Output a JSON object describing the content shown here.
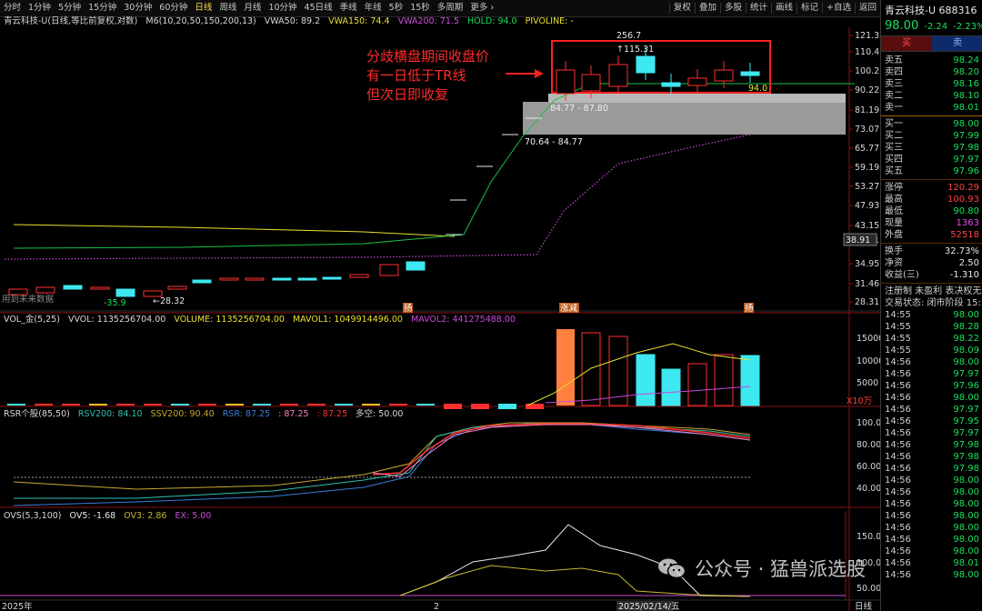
{
  "toolbar": {
    "periods": [
      "分时",
      "1分钟",
      "5分钟",
      "15分钟",
      "30分钟",
      "60分钟",
      "日线",
      "周线",
      "月线",
      "10分钟",
      "45日线",
      "季线",
      "年线",
      "5秒",
      "15秒",
      "多周期",
      "更多 ›"
    ],
    "active_period": "日线",
    "tools": [
      "复权",
      "叠加",
      "多股",
      "统计",
      "画线",
      "标记",
      "+自选",
      "返回"
    ]
  },
  "main_legend": {
    "name": "青云科技-U(日线,等比前复权,对数)",
    "ma": "M6(10,20,50,150,200,13)",
    "vwa50": "VWA50: 89.2",
    "vwa150": "VWA150: 74.4",
    "vwa200": "VWA200: 71.5",
    "hold": "HOLD: 94.0",
    "pivot": "PIVOLINE: -"
  },
  "price_axis": [
    "121.3",
    "110.42",
    "100.2",
    "90.22",
    "81.19",
    "73.07",
    "65.77",
    "59.19",
    "53.27",
    "47.93",
    "43.15",
    "38.91",
    "34.95",
    "31.46",
    "28.31"
  ],
  "main_labels": {
    "high_256": "256.7",
    "high_115": "115.31",
    "hold_val": "94.0",
    "low_2832": "←28.32",
    "neg_359": "-35.9",
    "range1": "84.77 - 87.80",
    "range2": "70.64 - 84.77",
    "cur_price": "38.91",
    "future": "用到未来数据",
    "tag_a": "扬",
    "tag_b": "涨减",
    "tag_c": "扬"
  },
  "annotation": [
    "分歧横盘期间收盘价",
    "有一日低于TR线",
    "但次日即收复"
  ],
  "vol_legend": {
    "name": "VOL_金(5,25)",
    "vvol": "VVOL: 1135256704.00",
    "volume": "VOLUME: 1135256704.00",
    "mavol1": "MAVOL1: 1049914496.00",
    "mavol2": "MAVOL2: 441275488.00"
  },
  "vol_axis": [
    "15000",
    "10000",
    "5000"
  ],
  "vol_unit": "X10万",
  "rsr_legend": {
    "name": "RSR个股(85,50)",
    "rsv200": "RSV200: 84.10",
    "ssv200": "SSV200: 90.40",
    "rsr": "RSR: 87.25",
    "v2": ": 87.25",
    "v3": ": 87.25",
    "duokong": "多空: 50.00"
  },
  "rsr_axis": [
    "100.0",
    "80.00",
    "60.00",
    "40.00"
  ],
  "ovs_legend": {
    "name": "OVS(5,3,100)",
    "ov5": "OV5: -1.68",
    "ov3": "OV3: 2.86",
    "ex": "EX: 5.00"
  },
  "ovs_axis": [
    "150.0",
    "100.0",
    "50.00"
  ],
  "date_labels": {
    "left": "2025年",
    "mid": "2",
    "date": "2025/02/14/五",
    "period": "日线"
  },
  "watermark": "公众号 · 猛兽派选股",
  "quote": {
    "title": "青云科技-U 688316",
    "price": "98.00",
    "change": "-2.24",
    "pct": "-2.23%",
    "buy_btn": "买",
    "sell_btn": "卖",
    "asks": [
      [
        "卖五",
        "98.24"
      ],
      [
        "卖四",
        "98.20"
      ],
      [
        "卖三",
        "98.16"
      ],
      [
        "卖二",
        "98.10"
      ],
      [
        "卖一",
        "98.01"
      ]
    ],
    "bids": [
      [
        "买一",
        "98.00"
      ],
      [
        "买二",
        "97.99"
      ],
      [
        "买三",
        "97.98"
      ],
      [
        "买四",
        "97.97"
      ],
      [
        "买五",
        "97.96"
      ]
    ],
    "stats1": [
      [
        "涨停",
        "120.29"
      ],
      [
        "最高",
        "100.93"
      ],
      [
        "最低",
        "90.80"
      ],
      [
        "现量",
        "1363"
      ],
      [
        "外盘",
        "52518"
      ]
    ],
    "stats2": [
      [
        "换手",
        "32.73%"
      ],
      [
        "净资",
        "2.50"
      ],
      [
        "收益(三)",
        "-1.310"
      ]
    ],
    "reg": "注册制 未盈利 表决权无",
    "status": "交易状态: 闭市阶段 15:3",
    "ticks": [
      [
        "14:55",
        "98.00"
      ],
      [
        "14:55",
        "98.28"
      ],
      [
        "14:55",
        "98.22"
      ],
      [
        "14:55",
        "98.09"
      ],
      [
        "14:56",
        "98.00"
      ],
      [
        "14:56",
        "97.97"
      ],
      [
        "14:56",
        "97.96"
      ],
      [
        "14:56",
        "98.00"
      ],
      [
        "14:56",
        "97.97"
      ],
      [
        "14:56",
        "97.95"
      ],
      [
        "14:56",
        "97.97"
      ],
      [
        "14:56",
        "97.98"
      ],
      [
        "14:56",
        "97.98"
      ],
      [
        "14:56",
        "97.98"
      ],
      [
        "14:56",
        "98.00"
      ],
      [
        "14:56",
        "98.00"
      ],
      [
        "14:56",
        "98.00"
      ],
      [
        "14:56",
        "98.00"
      ],
      [
        "14:56",
        "98.00"
      ],
      [
        "14:56",
        "98.00"
      ],
      [
        "14:56",
        "98.00"
      ],
      [
        "14:56",
        "98.01"
      ],
      [
        "14:56",
        "98.00"
      ]
    ]
  },
  "colors": {
    "up": "#ff3030",
    "down": "#3ee8f0",
    "green": "#19e05a",
    "yellow": "#e8e030",
    "purple": "#c84ad8"
  }
}
